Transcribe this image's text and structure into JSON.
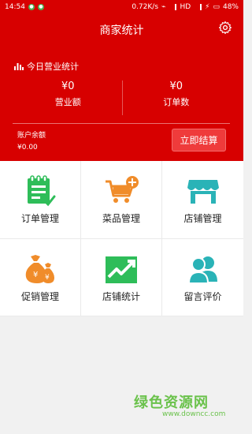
{
  "status_bar": {
    "time": "14:54",
    "network_speed": "0.72K/s",
    "network_type": "HD",
    "battery": "48%"
  },
  "header": {
    "title": "商家统计",
    "today_label": "今日营业统计",
    "revenue_value": "¥0",
    "revenue_label": "营业额",
    "orders_value": "¥0",
    "orders_label": "订单数",
    "balance_label": "账户余额",
    "balance_value": "¥0.00",
    "settle_button": "立即结算"
  },
  "menu": [
    {
      "label": "订单管理",
      "icon": "order-clipboard-icon"
    },
    {
      "label": "菜品管理",
      "icon": "shopping-cart-add-icon"
    },
    {
      "label": "店铺管理",
      "icon": "storefront-icon"
    },
    {
      "label": "促销管理",
      "icon": "money-bag-icon"
    },
    {
      "label": "店铺统计",
      "icon": "trend-up-icon"
    },
    {
      "label": "留言评价",
      "icon": "users-icon"
    }
  ],
  "watermark": {
    "main": "绿色资源网",
    "sub": "www.downcc.com"
  },
  "colors": {
    "header_red": "#d70000",
    "button_red": "#ef3b3b",
    "green": "#2ebd59",
    "orange": "#f08c2a",
    "teal": "#2ab3b7"
  }
}
